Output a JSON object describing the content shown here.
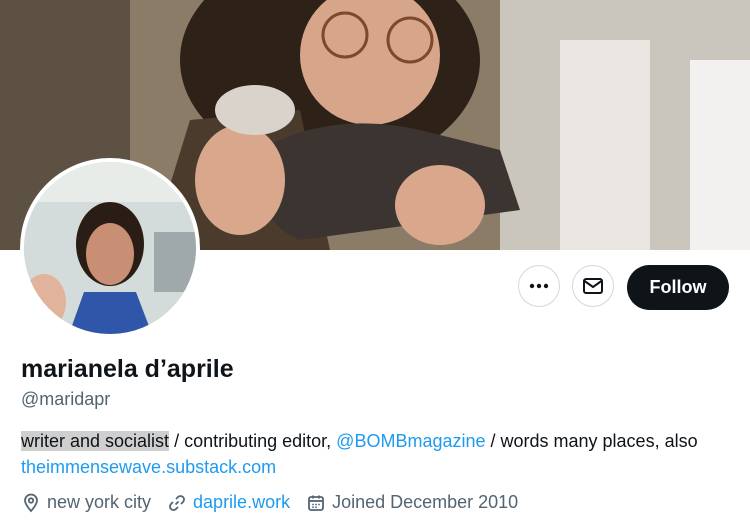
{
  "profile": {
    "display_name": "marianela d’aprile",
    "handle": "@maridapr",
    "bio": {
      "highlight": "writer and socialist",
      "text1": " / contributing editor, ",
      "mention": "@BOMBmagazine",
      "text2": " / words many places, also ",
      "link": "theimmensewave.substack.com"
    },
    "location": "new york city",
    "website": "daprile.work",
    "joined": "Joined December 2010"
  },
  "actions": {
    "follow_label": "Follow",
    "more_icon": "more-icon",
    "message_icon": "mail-icon"
  },
  "colors": {
    "accent": "#1d9bf0",
    "follow_bg": "#0f1419",
    "muted_text": "#536471"
  }
}
